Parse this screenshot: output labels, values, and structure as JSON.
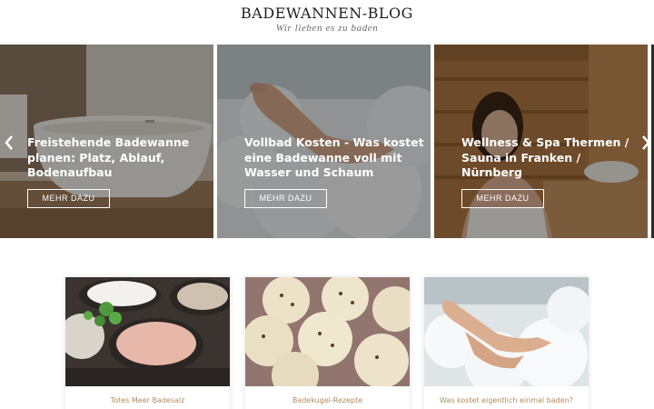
{
  "header": {
    "title": "BADEWANNEN-BLOG",
    "tagline": "Wir lieben es zu baden"
  },
  "slider": {
    "slides": [
      {
        "title": "Freistehende Badewanne planen: Platz, Ablauf, Bodenaufbau",
        "button": "MEHR DAZU"
      },
      {
        "title": "Vollbad Kosten - Was kostet eine Badewanne voll mit Wasser und Schaum",
        "button": "MEHR DAZU"
      },
      {
        "title": "Wellness & Spa Thermen / Sauna in Franken / Nürnberg",
        "button": "MEHR DAZU"
      }
    ],
    "prev_icon": "chevron-left-icon",
    "next_icon": "chevron-right-icon"
  },
  "cards": [
    {
      "title": "Totes Meer Badesalz"
    },
    {
      "title": "Badekugel-Rezepte"
    },
    {
      "title": "Was kostet eigentlich einmal baden?"
    }
  ],
  "colors": {
    "card_title": "#b38a5a",
    "header_text": "#1f1f1f",
    "slide_text": "#ffffff"
  }
}
